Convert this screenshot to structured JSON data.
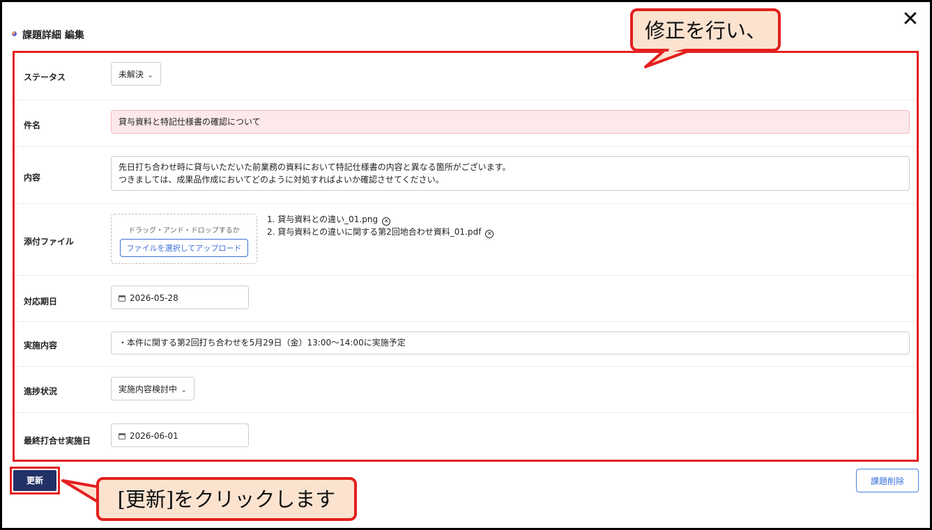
{
  "dialog": {
    "title": "課題詳細 編集",
    "close_label": "✕"
  },
  "form": {
    "status": {
      "label": "ステータス",
      "value": "未解決"
    },
    "subject": {
      "label": "件名",
      "value": "貸与資料と特記仕様書の確認について"
    },
    "content": {
      "label": "内容",
      "lines": [
        "先日打ち合わせ時に貸与いただいた前業務の資料において特記仕様書の内容と異なる箇所がございます。",
        "つきましては、成果品作成においてどのように対処すればよいか確認させてください。"
      ]
    },
    "attachments": {
      "label": "添付ファイル",
      "dropzone_text": "ドラッグ・アンド・ドロップするか",
      "upload_button": "ファイルを選択してアップロード",
      "files": [
        "1. 貸与資料との違い_01.png",
        "2. 貸与資料との違いに関する第2回地合わせ資料_01.pdf"
      ]
    },
    "due_date": {
      "label": "対応期日",
      "value": "2026-05-28"
    },
    "implementation": {
      "label": "実施内容",
      "value": "・本件に関する第2回打ち合わせを5月29日（金）13:00～14:00に実施予定"
    },
    "progress": {
      "label": "進捗状況",
      "value": "実施内容検討中"
    },
    "last_meeting": {
      "label": "最終打合せ実施日",
      "value": "2026-06-01"
    }
  },
  "buttons": {
    "update": "更新",
    "delete": "課題削除"
  },
  "callouts": {
    "top": "修正を行い、",
    "bottom": "[更新]をクリックします"
  },
  "colors": {
    "highlight_red": "#e41f1f",
    "callout_fill": "#fbe3d0",
    "primary_navy": "#223166",
    "link_blue": "#3a6fd8",
    "error_fill": "#fde8ea"
  }
}
